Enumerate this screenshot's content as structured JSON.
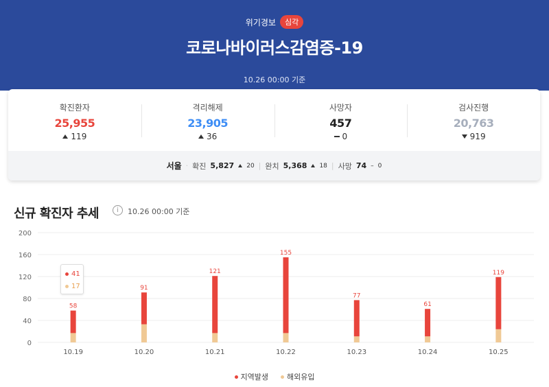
{
  "header": {
    "alert_label": "위기경보",
    "alert_level": "심각",
    "title": "코로나바이러스감염증-19",
    "basis": "10.26 00:00 기준"
  },
  "stats": [
    {
      "label": "확진환자",
      "value": "25,955",
      "delta": "119",
      "direction": "up",
      "color": "#e8453c"
    },
    {
      "label": "격리해제",
      "value": "23,905",
      "delta": "36",
      "direction": "up",
      "color": "#3d8df5"
    },
    {
      "label": "사망자",
      "value": "457",
      "delta": "0",
      "direction": "none",
      "color": "#222222"
    },
    {
      "label": "검사진행",
      "value": "20,763",
      "delta": "919",
      "direction": "down",
      "color": "#a6aebc"
    }
  ],
  "region": {
    "city": "서울",
    "confirmed_label": "확진",
    "confirmed": "5,827",
    "confirmed_delta": "20",
    "released_label": "완치",
    "released": "5,368",
    "released_delta": "18",
    "deaths_label": "사망",
    "deaths": "74",
    "deaths_delta": "0"
  },
  "trend": {
    "title": "신규 확진자 추세",
    "info_icon": "i",
    "basis": "10.26 00:00 기준",
    "tooltip": {
      "local": "41",
      "imported": "17"
    }
  },
  "chart_data": {
    "type": "bar",
    "stacked": true,
    "categories": [
      "10.19",
      "10.20",
      "10.21",
      "10.22",
      "10.23",
      "10.24",
      "10.25"
    ],
    "series": [
      {
        "name": "해외유입",
        "values": [
          17,
          33,
          17,
          17,
          11,
          11,
          24
        ],
        "color": "#f0c995"
      },
      {
        "name": "지역발생",
        "values": [
          41,
          58,
          104,
          138,
          66,
          50,
          95
        ],
        "color": "#e8453c"
      }
    ],
    "totals": [
      58,
      91,
      121,
      155,
      77,
      61,
      119
    ],
    "yticks": [
      0,
      40,
      80,
      120,
      160,
      200
    ],
    "ylim": [
      0,
      200
    ],
    "grid": true,
    "legend": "bottom-center"
  },
  "legend": {
    "local": "지역발생",
    "imported": "해외유입"
  }
}
